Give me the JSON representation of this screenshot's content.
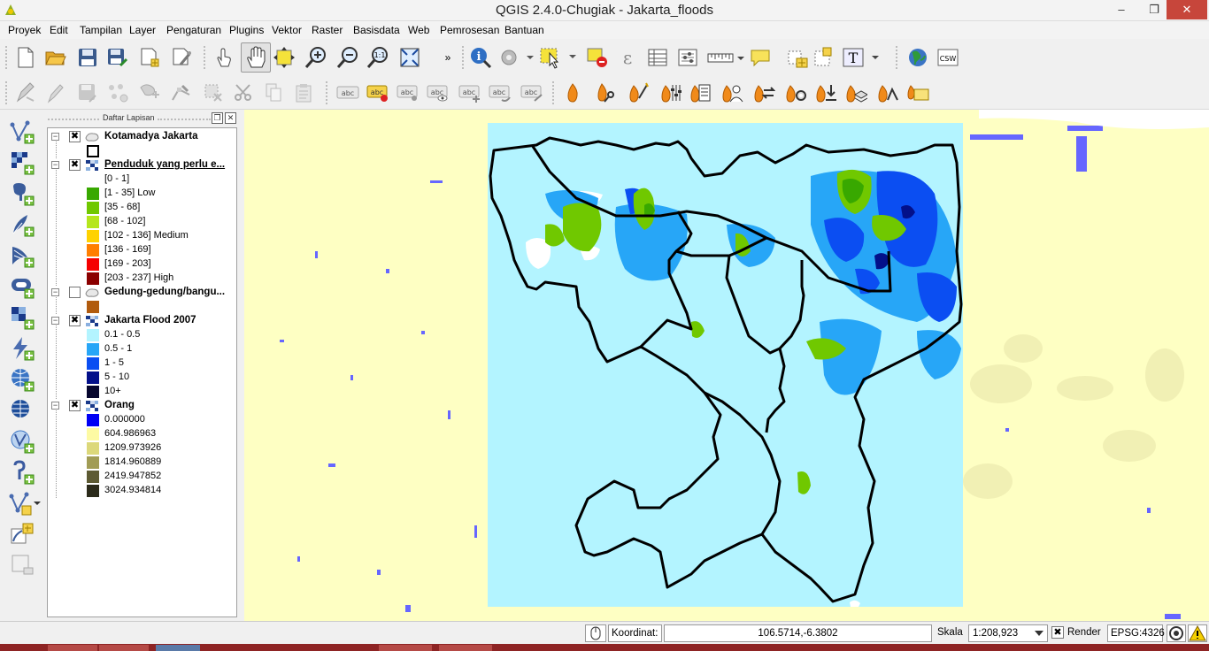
{
  "window": {
    "title": "QGIS 2.4.0-Chugiak - Jakarta_floods",
    "minimize_label": "–",
    "maximize_label": "❐",
    "close_label": "✕"
  },
  "menu": [
    "Proyek",
    "Edit",
    "Tampilan",
    "Layer",
    "Pengaturan",
    "Plugins",
    "Vektor",
    "Raster",
    "Basisdata",
    "Web",
    "Pemrosesan",
    "Bantuan"
  ],
  "toolbar": {
    "more_label": "»",
    "csw_label": "CSW",
    "abc_label": "abc"
  },
  "panel": {
    "title": "Daftar Lapisan",
    "float_label": "❐",
    "close_label": "✕"
  },
  "layers": [
    {
      "name": "Kotamadya Jakarta",
      "checked": true,
      "expanded": true,
      "type": "polygon",
      "underline": false,
      "classes": [
        {
          "label": "",
          "color": "#ffffff",
          "outline": true
        }
      ]
    },
    {
      "name": "Penduduk yang perlu e...",
      "checked": true,
      "expanded": true,
      "type": "raster",
      "underline": true,
      "classes": [
        {
          "label": "[0 - 1]",
          "color": ""
        },
        {
          "label": "[1 - 35] Low",
          "color": "#38a800"
        },
        {
          "label": "[35 - 68]",
          "color": "#70c800"
        },
        {
          "label": "[68 - 102]",
          "color": "#b5e61d"
        },
        {
          "label": "[102 - 136] Medium",
          "color": "#ffd200"
        },
        {
          "label": "[136 - 169]",
          "color": "#ff7f00"
        },
        {
          "label": "[169 - 203]",
          "color": "#f50000"
        },
        {
          "label": "[203 - 237] High",
          "color": "#8b0000"
        }
      ]
    },
    {
      "name": "Gedung-gedung/bangu...",
      "checked": false,
      "expanded": true,
      "type": "polygon",
      "underline": false,
      "classes": [
        {
          "label": "",
          "color": "#b15b0e",
          "outline": false
        }
      ]
    },
    {
      "name": "Jakarta Flood 2007",
      "checked": true,
      "expanded": true,
      "type": "raster",
      "underline": false,
      "classes": [
        {
          "label": "0.1 - 0.5",
          "color": "#b3f4ff"
        },
        {
          "label": "0.5 - 1",
          "color": "#27a6f7"
        },
        {
          "label": "1 - 5",
          "color": "#0b4ef2"
        },
        {
          "label": "5 - 10",
          "color": "#03108a"
        },
        {
          "label": "10+",
          "color": "#06062e"
        }
      ]
    },
    {
      "name": "Orang",
      "checked": true,
      "expanded": true,
      "type": "raster",
      "underline": false,
      "classes": [
        {
          "label": "0.000000",
          "color": "#0000f5"
        },
        {
          "label": "604.986963",
          "color": "#fdfaa3"
        },
        {
          "label": "1209.973926",
          "color": "#dcd87a"
        },
        {
          "label": "1814.960889",
          "color": "#a19c55"
        },
        {
          "label": "2419.947852",
          "color": "#5d5a33"
        },
        {
          "label": "3024.934814",
          "color": "#2b2a1a"
        }
      ]
    }
  ],
  "map": {
    "background": "#feffc3",
    "flood_extent_color": "#b3f4ff",
    "boundary_color": "#000000"
  },
  "status": {
    "coord_label": "Koordinat:",
    "coord_value": "106.5714,-6.3802",
    "scale_label": "Skala",
    "scale_value": "1:208,923",
    "render_label": "Render",
    "render_checked": true,
    "epsg_label": "EPSG:4326"
  }
}
